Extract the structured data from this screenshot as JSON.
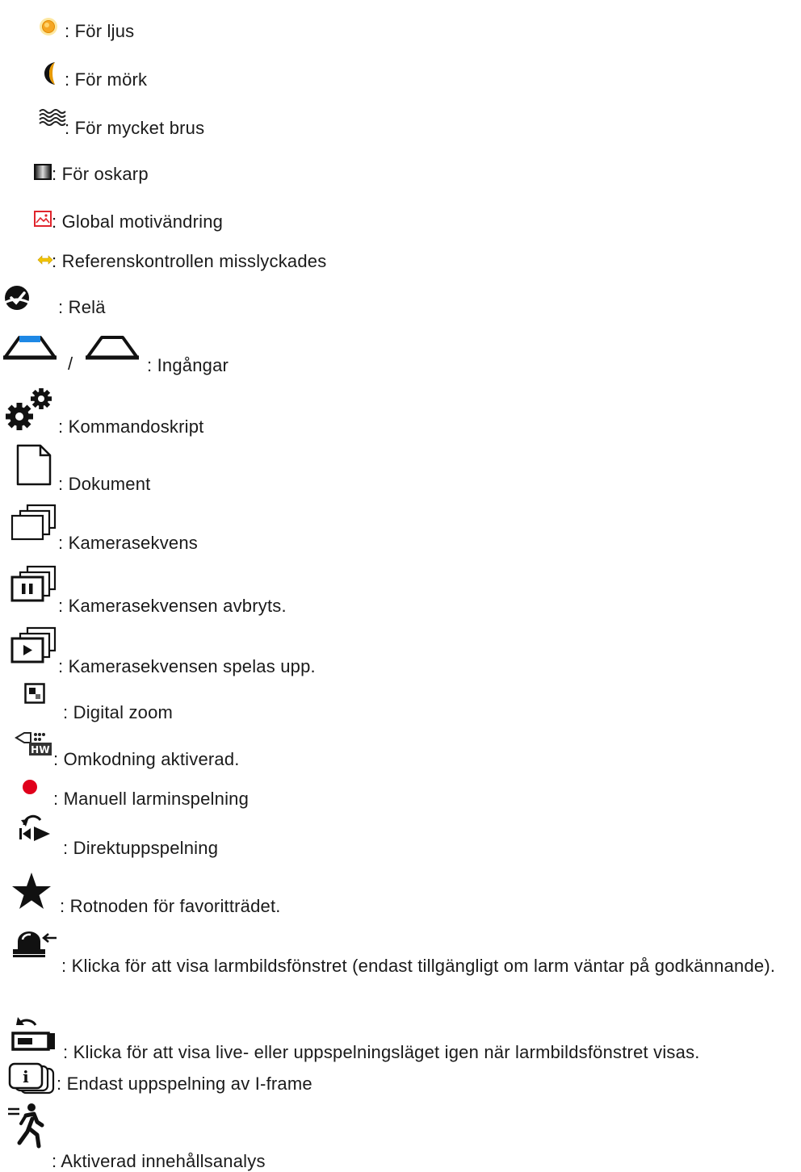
{
  "items": [
    {
      "icon": "too-bright-icon",
      "text": ": För ljus"
    },
    {
      "icon": "too-dark-icon",
      "text": ": För mörk"
    },
    {
      "icon": "too-noisy-icon",
      "text": ": För mycket brus"
    },
    {
      "icon": "too-blurry-icon",
      "text": ": För oskarp"
    },
    {
      "icon": "global-scene-change-icon",
      "text": ": Global motivändring"
    },
    {
      "icon": "reference-check-failed-icon",
      "text": ": Referenskontrollen misslyckades"
    },
    {
      "icon": "relay-icon",
      "text": ": Relä"
    },
    {
      "icon": "input-icon",
      "text": ": Ingångar",
      "separator": "/"
    },
    {
      "icon": "command-script-icon",
      "text": ": Kommandoskript"
    },
    {
      "icon": "document-icon",
      "text": ": Dokument"
    },
    {
      "icon": "camera-sequence-icon",
      "text": ": Kamerasekvens"
    },
    {
      "icon": "camera-sequence-paused-icon",
      "text": ": Kamerasekvensen avbryts."
    },
    {
      "icon": "camera-sequence-playing-icon",
      "text": ": Kamerasekvensen spelas upp."
    },
    {
      "icon": "digital-zoom-icon",
      "text": ": Digital zoom"
    },
    {
      "icon": "transcoding-icon",
      "text": ": Omkodning aktiverad."
    },
    {
      "icon": "manual-alarm-recording-icon",
      "text": ": Manuell larminspelning"
    },
    {
      "icon": "instant-playback-icon",
      "text": ": Direktuppspelning"
    },
    {
      "icon": "favorites-root-star-icon",
      "text": ": Rotnoden för favoritträdet."
    },
    {
      "icon": "alarm-image-window-icon",
      "text": ": Klicka för att visa larmbildsfönstret (endast tillgängligt om larm väntar på godkännande)."
    },
    {
      "icon": "return-live-playback-icon",
      "text": ": Klicka för att visa live- eller uppspelningsläget igen när larmbildsfönstret visas."
    },
    {
      "icon": "i-frame-playback-icon",
      "text": ": Endast uppspelning av I-frame"
    },
    {
      "icon": "content-analysis-icon",
      "text": ": Aktiverad innehållsanalys"
    }
  ],
  "colors": {
    "text": "#1a1a1a",
    "sun": "#f5a623",
    "moon": "#e89a00",
    "scene_change": "#e0242c",
    "reference_arrow": "#f2c400",
    "input_blue": "#1e88e5",
    "record_red": "#e0001b",
    "icon_dark": "#1a1a1a"
  }
}
